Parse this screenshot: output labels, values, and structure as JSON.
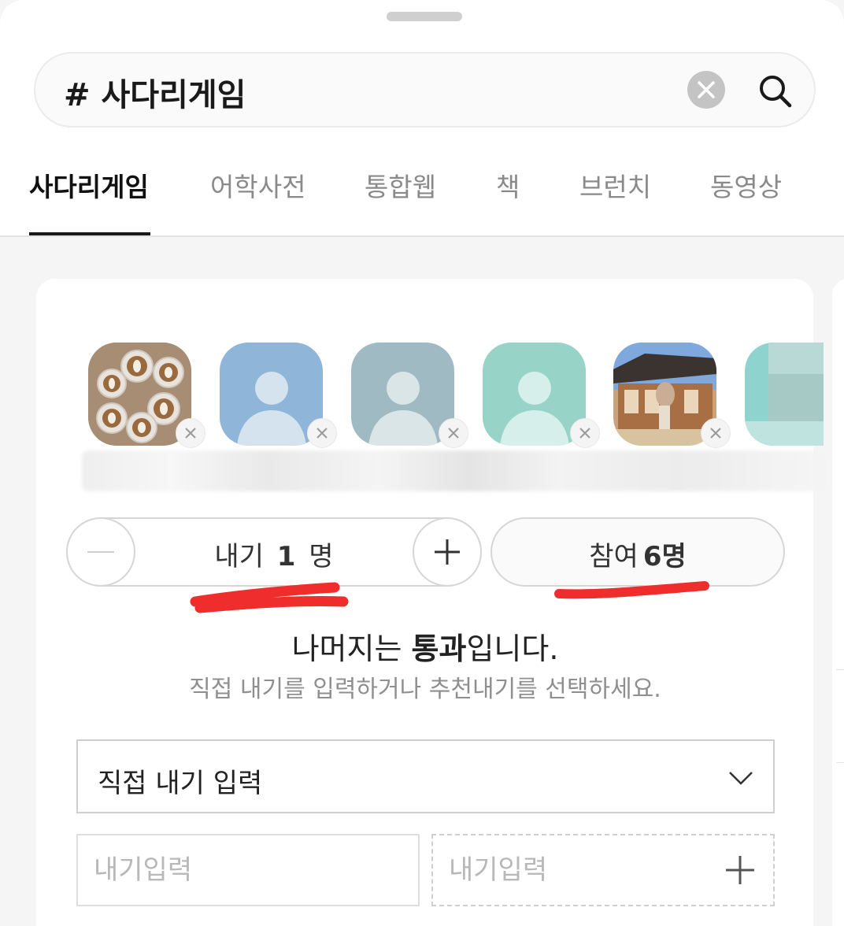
{
  "search": {
    "query": "# 사다리게임",
    "clear_icon": "close-icon",
    "search_icon": "search-icon"
  },
  "tabs": [
    {
      "label": "사다리게임",
      "active": true
    },
    {
      "label": "어학사전",
      "active": false
    },
    {
      "label": "통합웹",
      "active": false
    },
    {
      "label": "책",
      "active": false
    },
    {
      "label": "브런치",
      "active": false
    },
    {
      "label": "동영상",
      "active": false
    }
  ],
  "participants": [
    {
      "avatar": "latte-art-photo"
    },
    {
      "avatar": "default-person",
      "color": "#8fb6d9"
    },
    {
      "avatar": "default-person",
      "color": "#9fbac3"
    },
    {
      "avatar": "default-person",
      "color": "#98d3c8"
    },
    {
      "avatar": "hanok-photo"
    },
    {
      "avatar": "blurred-photo"
    }
  ],
  "bet_stepper": {
    "prefix": "내기",
    "count": "1",
    "suffix": "명"
  },
  "join": {
    "prefix": "참여",
    "count": "6명"
  },
  "result": {
    "before": "나머지는 ",
    "bold": "통과",
    "after": "입니다."
  },
  "hint": "직접 내기를 입력하거나 추천내기를 선택하세요.",
  "bet_type_select": {
    "value": "직접 내기 입력"
  },
  "bet_inputs": {
    "placeholder_1": "내기입력",
    "placeholder_2": "내기입력"
  },
  "colors": {
    "accent_red": "#f02d2d",
    "tab_active": "#111111",
    "tab_inactive": "#8a8a8a"
  }
}
